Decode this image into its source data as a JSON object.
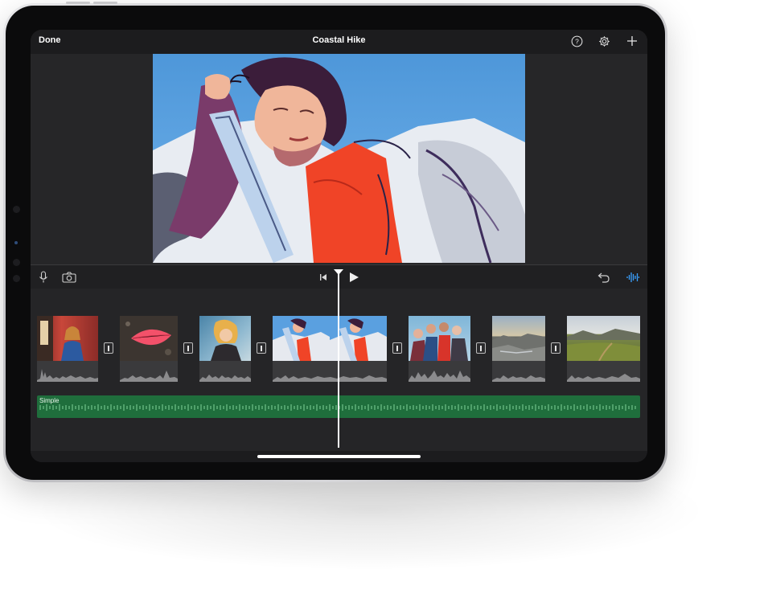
{
  "app": {
    "title": "Coastal Hike",
    "done_label": "Done"
  },
  "toolbar": {
    "icons": [
      "help-icon",
      "gear-icon",
      "plus-icon"
    ]
  },
  "controls": {
    "left_icons": [
      "microphone-icon",
      "camera-icon"
    ],
    "center_icons": [
      "skip-back-icon",
      "play-icon"
    ],
    "right_icons": [
      "undo-icon",
      "audio-waveform-icon"
    ]
  },
  "timeline": {
    "clips": [
      {
        "thumb": "woman-red-wall"
      },
      {
        "thumb": "red-leaf"
      },
      {
        "thumb": "woman-sunlit"
      },
      {
        "thumb": "woman-comic-style"
      },
      {
        "thumb": "group-friends"
      },
      {
        "thumb": "rocky-coast"
      },
      {
        "thumb": "green-valley"
      }
    ],
    "audio_track_label": "Simple"
  },
  "colors": {
    "audio_track": "#1f6e3c",
    "accent_waveform": "#3aa0ff",
    "background": "#252527"
  }
}
